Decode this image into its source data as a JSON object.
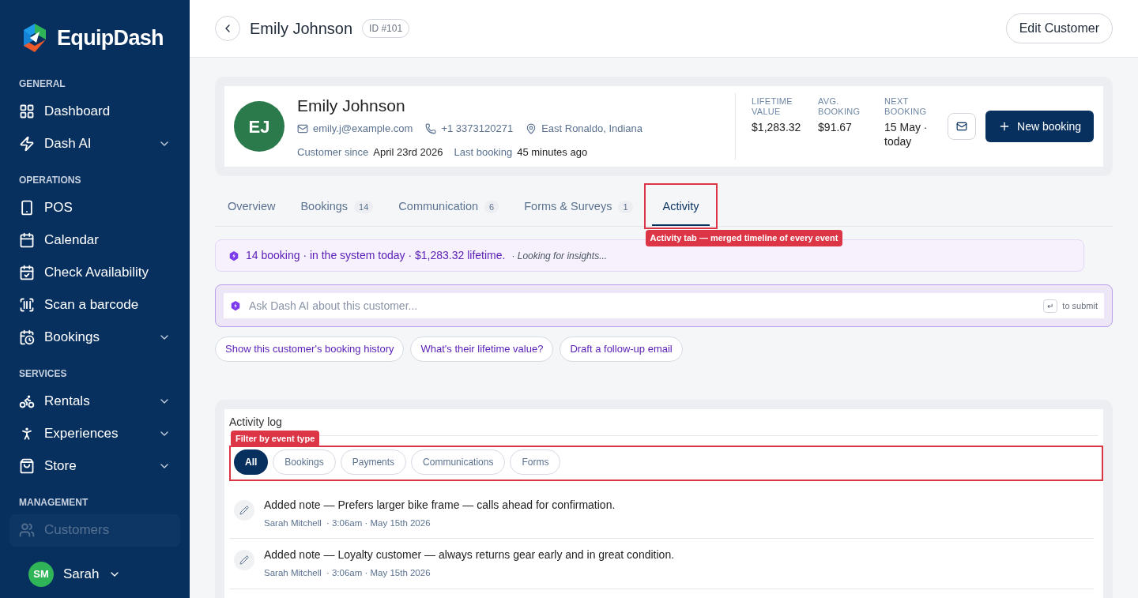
{
  "brand": {
    "name": "EquipDash"
  },
  "sidebar": {
    "sections": [
      {
        "title": "GENERAL",
        "items": [
          {
            "label": "Dashboard"
          },
          {
            "label": "Dash AI",
            "expanded": false
          }
        ]
      },
      {
        "title": "OPERATIONS",
        "items": [
          {
            "label": "POS"
          },
          {
            "label": "Calendar"
          },
          {
            "label": "Check Availability"
          },
          {
            "label": "Scan a barcode"
          },
          {
            "label": "Bookings",
            "expanded": false
          }
        ]
      },
      {
        "title": "SERVICES",
        "items": [
          {
            "label": "Rentals",
            "expanded": false
          },
          {
            "label": "Experiences",
            "expanded": false
          },
          {
            "label": "Store",
            "expanded": false
          }
        ]
      },
      {
        "title": "MANAGEMENT",
        "items": [
          {
            "label": "Customers",
            "selected": true
          }
        ]
      }
    ],
    "user": {
      "initials": "SM",
      "name": "Sarah"
    }
  },
  "header": {
    "title": "Emily Johnson",
    "id_badge": "ID #101",
    "edit_button": "Edit Customer"
  },
  "customer": {
    "initials": "EJ",
    "name": "Emily Johnson",
    "email": "emily.j@example.com",
    "phone": "+1 3373120271",
    "location": "East Ronaldo, Indiana",
    "since_label": "Customer since",
    "since_value": "April 23rd 2026",
    "last_label": "Last booking",
    "last_value": "45 minutes ago",
    "stats": [
      {
        "label": "LIFETIME VALUE",
        "value": "$1,283.32"
      },
      {
        "label": "AVG. BOOKING",
        "value": "$91.67"
      },
      {
        "label": "NEXT BOOKING",
        "value": "15 May · today"
      }
    ],
    "new_booking": "New booking"
  },
  "tabs": {
    "items": [
      {
        "label": "Overview",
        "selected": false
      },
      {
        "label": "Bookings",
        "count": "14",
        "selected": false
      },
      {
        "label": "Communication",
        "count": "6",
        "selected": false
      },
      {
        "label": "Forms & Surveys",
        "count": "1",
        "selected": false
      },
      {
        "label": "Activity",
        "selected": true
      }
    ],
    "callout": "Activity tab — merged timeline of every event"
  },
  "insight": {
    "text": "14 booking · in the system today · $1,283.32 lifetime.",
    "status": "· Looking for insights..."
  },
  "ask": {
    "placeholder": "Ask Dash AI about this customer...",
    "key": "↵",
    "hint": "to submit",
    "suggestions": [
      "Show this customer's booking history",
      "What's their lifetime value?",
      "Draft a follow-up email"
    ]
  },
  "activity_log": {
    "title": "Activity log",
    "callout": "Filter by event type",
    "filters": [
      {
        "label": "All",
        "selected": true
      },
      {
        "label": "Bookings",
        "selected": false
      },
      {
        "label": "Payments",
        "selected": false
      },
      {
        "label": "Communications",
        "selected": false
      },
      {
        "label": "Forms",
        "selected": false
      }
    ],
    "entries": [
      {
        "text": "Added note — Prefers larger bike frame — calls ahead for confirmation.",
        "author": "Sarah Mitchell",
        "time": "· 3:06am · May 15th 2026"
      },
      {
        "text": "Added note — Loyalty customer — always returns gear early and in great condition.",
        "author": "Sarah Mitchell",
        "time": "· 3:06am · May 15th 2026"
      }
    ]
  }
}
